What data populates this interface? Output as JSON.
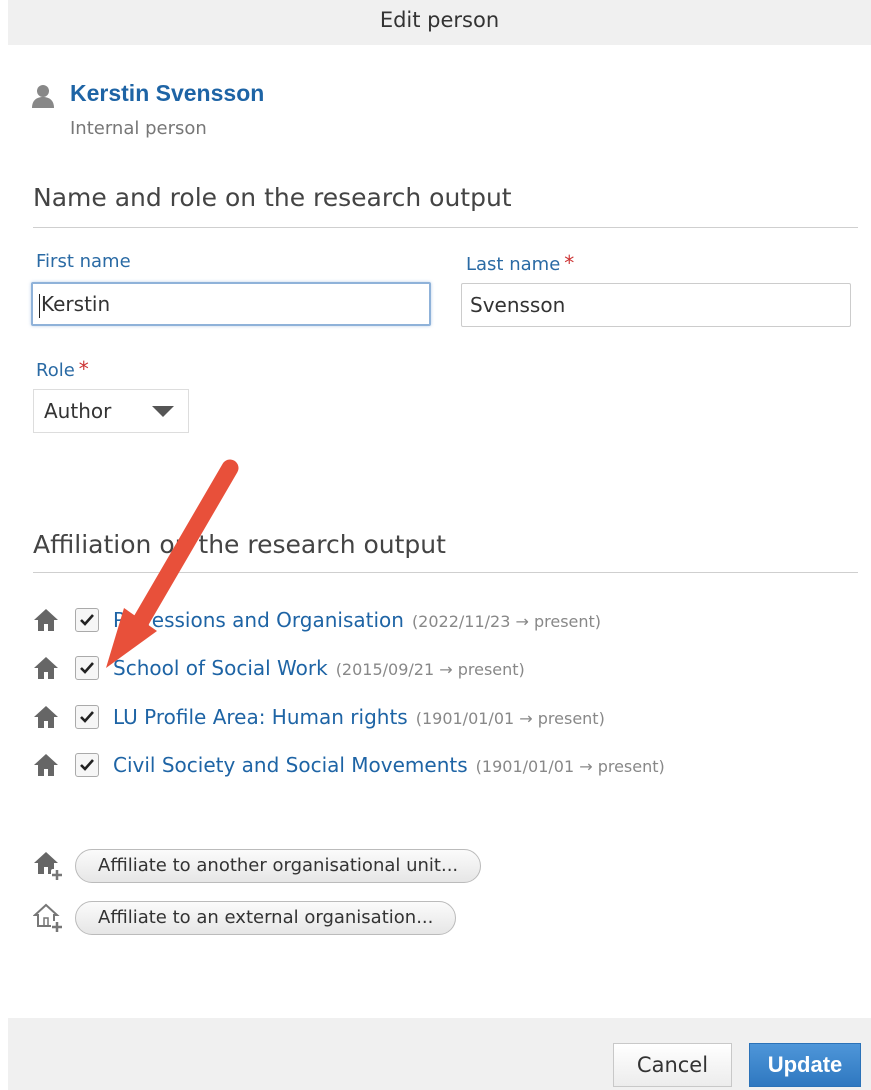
{
  "window": {
    "title": "Edit person"
  },
  "person": {
    "name": "Kerstin Svensson",
    "type": "Internal person"
  },
  "name_section": {
    "title": "Name and role on the research output",
    "first_name_label": "First name",
    "first_name_value": "Kerstin",
    "last_name_label": "Last name",
    "last_name_value": "Svensson",
    "required_mark": "*",
    "role_label": "Role",
    "role_value": "Author"
  },
  "affiliation_section": {
    "title": "Affiliation on the research output",
    "items": [
      {
        "name": "Professions and Organisation",
        "dates": "(2022/11/23 → present)",
        "checked": true
      },
      {
        "name": "School of Social Work",
        "dates": "(2015/09/21 → present)",
        "checked": true
      },
      {
        "name": "LU Profile Area: Human rights",
        "dates": "(1901/01/01 → present)",
        "checked": true
      },
      {
        "name": "Civil Society and Social Movements",
        "dates": "(1901/01/01 → present)",
        "checked": true
      }
    ],
    "affiliate_internal_label": "Affiliate to another organisational unit...",
    "affiliate_external_label": "Affiliate to an external organisation..."
  },
  "footer": {
    "cancel_label": "Cancel",
    "update_label": "Update"
  },
  "colors": {
    "link": "#1e64a5",
    "primary_button": "#3680c8",
    "annotation_arrow": "#e8503a"
  }
}
